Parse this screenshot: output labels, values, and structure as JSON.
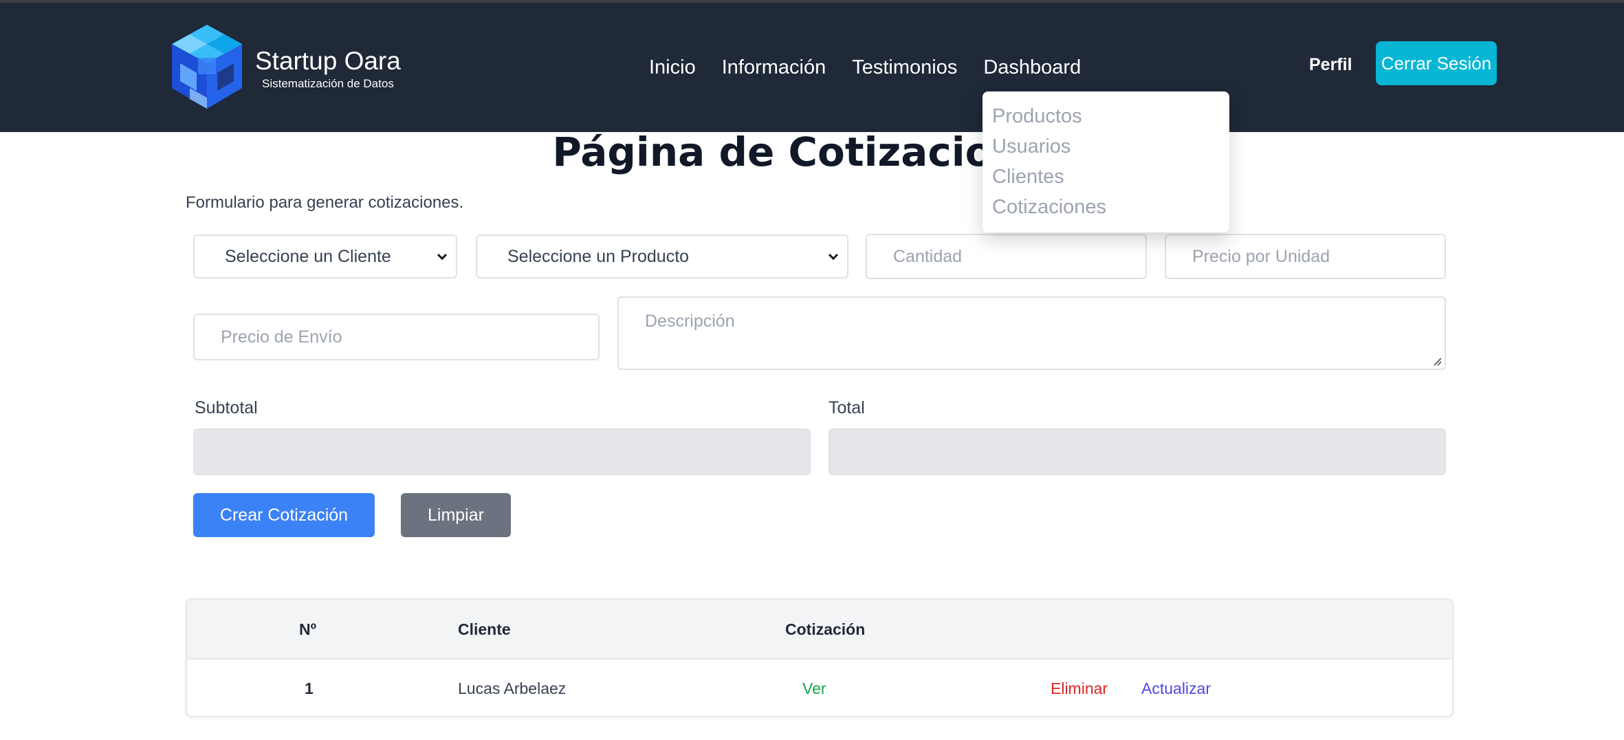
{
  "brand": {
    "title": "Startup Oara",
    "subtitle": "Sistematización de Datos"
  },
  "nav": {
    "items": [
      "Inicio",
      "Información",
      "Testimonios",
      "Dashboard"
    ]
  },
  "header": {
    "profile": "Perfil",
    "logout": "Cerrar Sesión"
  },
  "dashboard_menu": {
    "items": [
      "Productos",
      "Usuarios",
      "Clientes",
      "Cotizaciones"
    ]
  },
  "page": {
    "title": "Página de Cotizaciones",
    "subtitle": "Formulario para generar cotizaciones."
  },
  "form": {
    "client_select": "Seleccione un Cliente",
    "product_select": "Seleccione un Producto",
    "quantity_placeholder": "Cantidad",
    "unit_price_placeholder": "Precio por Unidad",
    "shipping_placeholder": "Precio de Envío",
    "description_placeholder": "Descripción",
    "subtotal_label": "Subtotal",
    "total_label": "Total",
    "create_button": "Crear Cotización",
    "clear_button": "Limpiar"
  },
  "table": {
    "headers": [
      "Nº",
      "Cliente",
      "Cotización"
    ],
    "rows": [
      {
        "num": "1",
        "client": "Lucas Arbelaez",
        "view": "Ver",
        "delete": "Eliminar",
        "update": "Actualizar"
      }
    ]
  },
  "colors": {
    "header_bg": "#1f2937",
    "logout_btn": "#06b6d4",
    "primary_btn": "#3b82f6",
    "secondary_btn": "#6b7280",
    "view_link": "#16a34a",
    "delete_link": "#dc2626",
    "update_link": "#4f46e5"
  }
}
